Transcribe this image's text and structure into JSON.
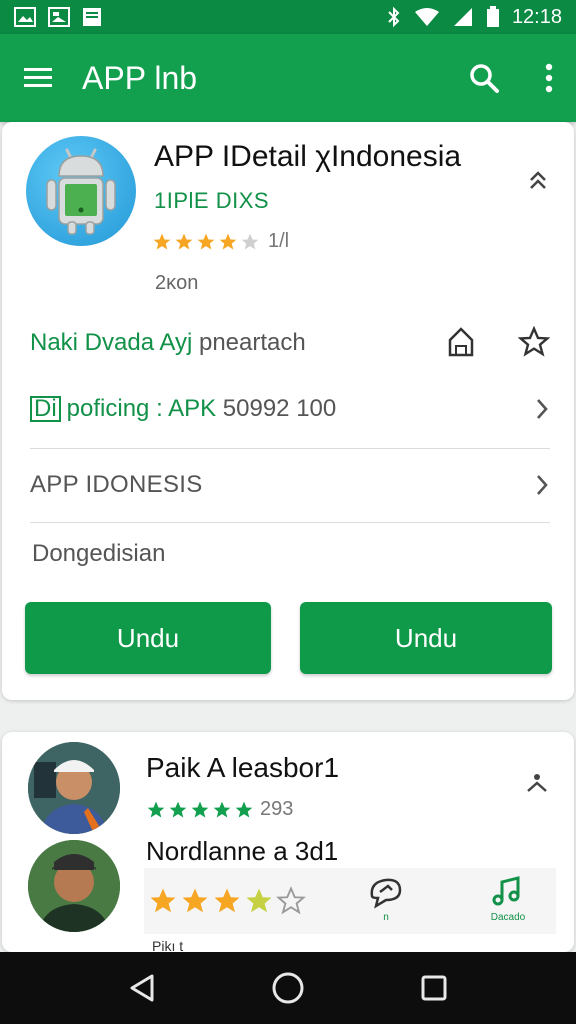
{
  "status_bar": {
    "time": "12:18"
  },
  "app_bar": {
    "title": "APP lnb"
  },
  "app_card": {
    "name": "APP IDetail χIndonesia",
    "developer": "1IPlE DIXS",
    "rating_value": 4,
    "rating_text": "1/l",
    "size": "2κon",
    "row_a": {
      "green_part": "Naki Dvada Ayj",
      "rest": "pneartach"
    },
    "row_b": {
      "boxed": "Di",
      "label_green": "poficing : APK",
      "number": "50992 100"
    },
    "row_c": {
      "label": "APP IDONESIS"
    },
    "description": "Dongedisian",
    "button_1": "Undu",
    "button_2": "Undu"
  },
  "reviews": {
    "reviewer_1": {
      "name": "Paik A leasbor1",
      "rating": 5,
      "count": "293"
    },
    "reviewer_2": {
      "name": "Nordlanne a 3d1",
      "rating": 4
    },
    "toolbar": {
      "icon_1_label": "n",
      "icon_2_label": "Dacado"
    },
    "cut_text": "Pikı t"
  },
  "colors": {
    "status_bar": "#0b8a43",
    "app_bar": "#12a04e",
    "button": "#0f9a4a",
    "star": "#f6a623",
    "accent_green": "#129148"
  },
  "icons": {
    "status_left": [
      "gallery-icon",
      "image-icon",
      "message-icon"
    ],
    "status_right": [
      "bluetooth-icon",
      "wifi-icon",
      "signal-icon",
      "battery-icon"
    ],
    "app_bar": [
      "menu-icon",
      "search-icon",
      "more-vert-icon"
    ],
    "nav": [
      "back-icon",
      "home-icon",
      "recents-icon"
    ]
  }
}
